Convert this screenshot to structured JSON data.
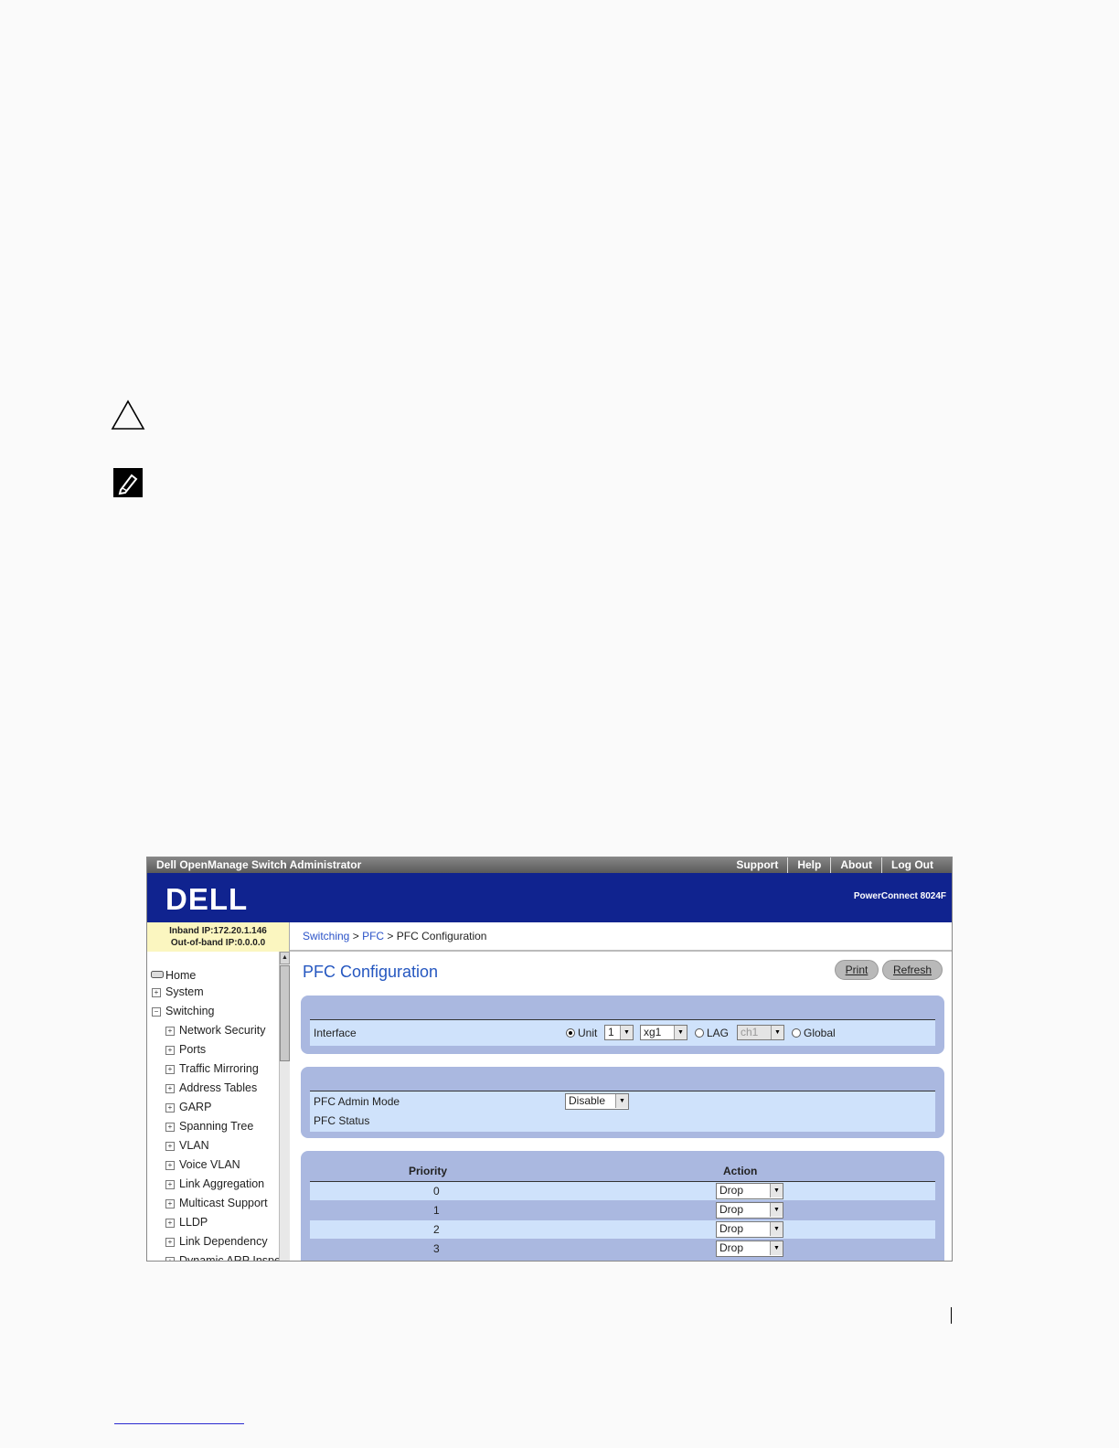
{
  "window": {
    "app_title": "Dell OpenManage Switch Administrator",
    "top_links": [
      "Support",
      "Help",
      "About",
      "Log Out"
    ],
    "model": "PowerConnect 8024F",
    "logo_text": "DELL"
  },
  "ip": {
    "inband": "Inband IP:172.20.1.146",
    "outband": "Out-of-band IP:0.0.0.0"
  },
  "breadcrumb": {
    "part1": "Switching",
    "sep": ">",
    "part2": "PFC",
    "current": "PFC Configuration"
  },
  "sidebar": {
    "items": [
      "Home",
      "System",
      "Switching",
      "Network Security",
      "Ports",
      "Traffic Mirroring",
      "Address Tables",
      "GARP",
      "Spanning Tree",
      "VLAN",
      "Voice VLAN",
      "Link Aggregation",
      "Multicast Support",
      "LLDP",
      "Link Dependency",
      "Dynamic ARP Inspe"
    ]
  },
  "page": {
    "title": "PFC Configuration",
    "print_label": "Print",
    "refresh_label": "Refresh"
  },
  "interface": {
    "label": "Interface",
    "unit_label": "Unit",
    "unit_value": "1",
    "port_value": "xg1",
    "lag_label": "LAG",
    "lag_value": "ch1",
    "global_label": "Global",
    "selected": "Unit"
  },
  "pfc": {
    "admin_mode_label": "PFC Admin Mode",
    "admin_mode_value": "Disable",
    "status_label": "PFC Status",
    "status_value": ""
  },
  "priority_table": {
    "headers": [
      "Priority",
      "Action"
    ],
    "rows": [
      {
        "priority": "0",
        "action": "Drop"
      },
      {
        "priority": "1",
        "action": "Drop"
      },
      {
        "priority": "2",
        "action": "Drop"
      },
      {
        "priority": "3",
        "action": "Drop"
      }
    ]
  },
  "colors": {
    "banner": "#10238f",
    "panel": "#aab8e0",
    "panel_inner": "#cfe2fb",
    "title": "#2557c0"
  }
}
